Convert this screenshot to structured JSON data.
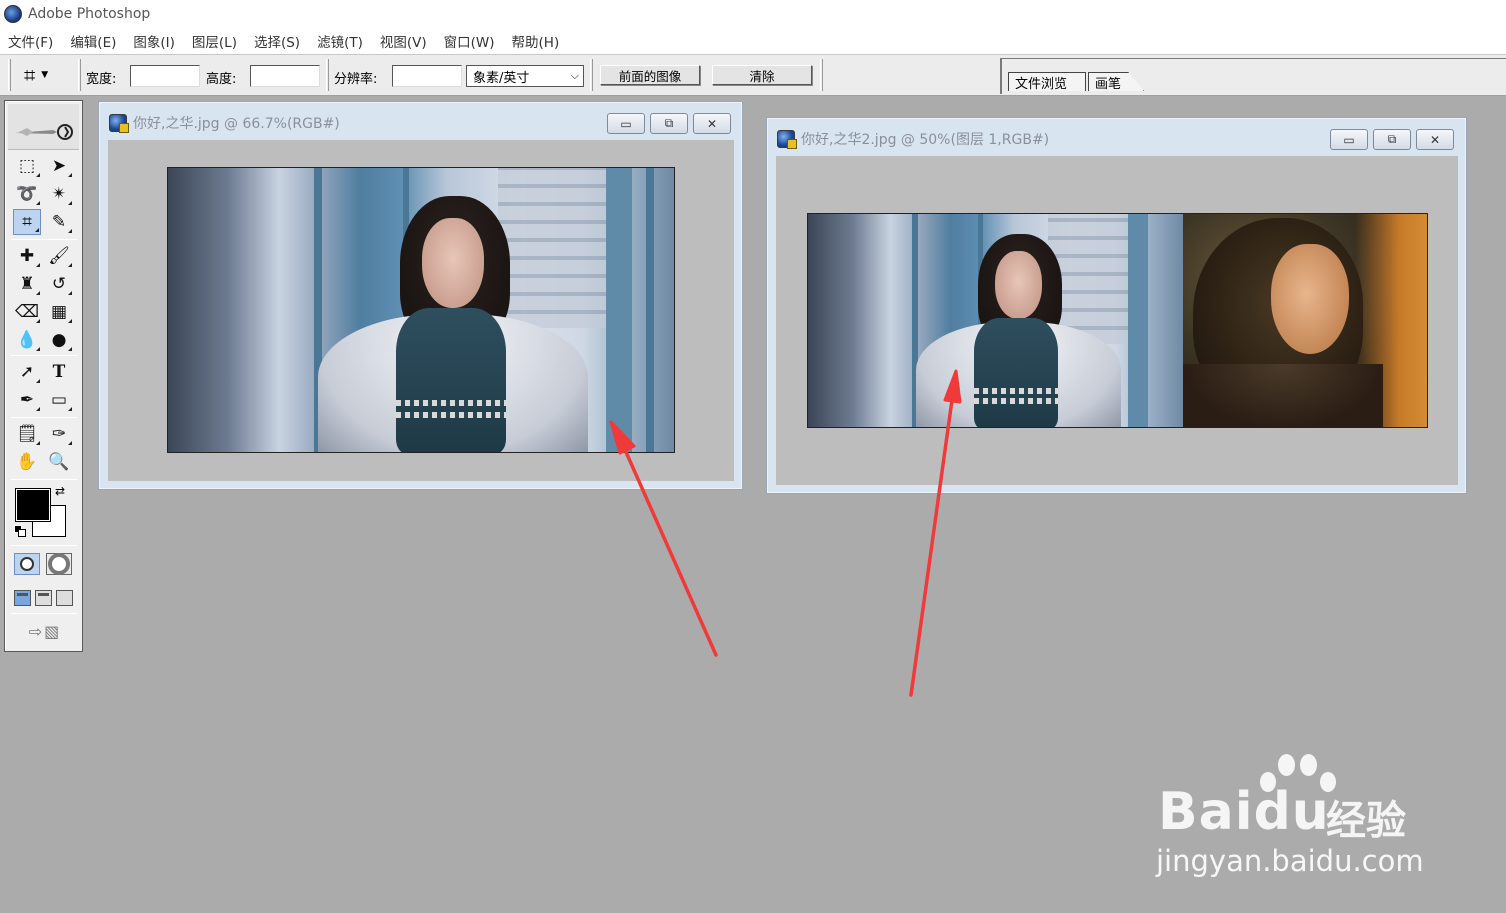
{
  "app": {
    "title": "Adobe Photoshop",
    "icon": "photoshop-eye-icon"
  },
  "menu": [
    "文件(F)",
    "编辑(E)",
    "图象(I)",
    "图层(L)",
    "选择(S)",
    "滤镜(T)",
    "视图(V)",
    "窗口(W)",
    "帮助(H)"
  ],
  "options_bar": {
    "tool_icon": "crop-icon",
    "width_label": "宽度:",
    "width_value": "",
    "height_label": "高度:",
    "height_value": "",
    "resolution_label": "分辨率:",
    "resolution_value": "",
    "unit_select": "象素/英寸",
    "front_image_button": "前面的图像",
    "clear_button": "清除"
  },
  "palette_well": {
    "tabs": [
      "文件浏览",
      "画笔"
    ]
  },
  "toolbox": {
    "tools": [
      "rectangular-marquee-icon",
      "move-icon",
      "lasso-icon",
      "magic-wand-icon",
      "crop-icon",
      "slice-icon",
      "healing-brush-icon",
      "brush-icon",
      "clone-stamp-icon",
      "history-brush-icon",
      "eraser-icon",
      "gradient-icon",
      "blur-icon",
      "dodge-icon",
      "path-selection-icon",
      "type-icon",
      "pen-icon",
      "rectangle-shape-icon",
      "notes-icon",
      "eyedropper-icon",
      "hand-icon",
      "zoom-icon"
    ],
    "active_tool": "crop-icon",
    "foreground_color": "#000000",
    "background_color": "#ffffff"
  },
  "documents": [
    {
      "title": "你好,之华.jpg @ 66.7%(RGB#)"
    },
    {
      "title": "你好,之华2.jpg @ 50%(图层 1,RGB#)"
    }
  ],
  "window_controls": {
    "minimize": "▭",
    "maximize": "⧉",
    "close": "✕"
  },
  "annotation_color": "#f03a3a",
  "watermark": {
    "brand": "Bai",
    "brand_du": "du",
    "product": "经验",
    "url": "jingyan.baidu.com"
  },
  "colors": {
    "workspace": "#ababab",
    "doc_frame": "#d9e4f1",
    "canvas_bg": "#bdbdbd"
  }
}
